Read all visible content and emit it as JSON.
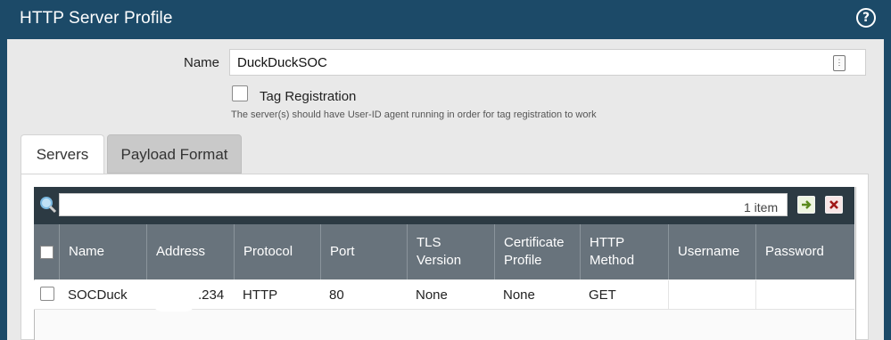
{
  "dialog": {
    "title": "HTTP Server Profile",
    "help_icon": "help-icon"
  },
  "form": {
    "name_label": "Name",
    "name_value": "DuckDuckSOC",
    "tag_registration_label": "Tag Registration",
    "tag_registration_checked": false,
    "tag_hint": "The server(s) should have User-ID agent running in order for tag registration to work"
  },
  "tabs": [
    {
      "label": "Servers",
      "active": true
    },
    {
      "label": "Payload Format",
      "active": false
    }
  ],
  "grid": {
    "item_count": "1 item",
    "columns": [
      "Name",
      "Address",
      "Protocol",
      "Port",
      "TLS Version",
      "Certificate Profile",
      "HTTP Method",
      "Username",
      "Password"
    ],
    "rows": [
      {
        "name": "SOCDuck",
        "address": ".234",
        "protocol": "HTTP",
        "port": "80",
        "tls_version": "None",
        "certificate_profile": "None",
        "http_method": "GET",
        "username": "",
        "password": ""
      }
    ]
  }
}
